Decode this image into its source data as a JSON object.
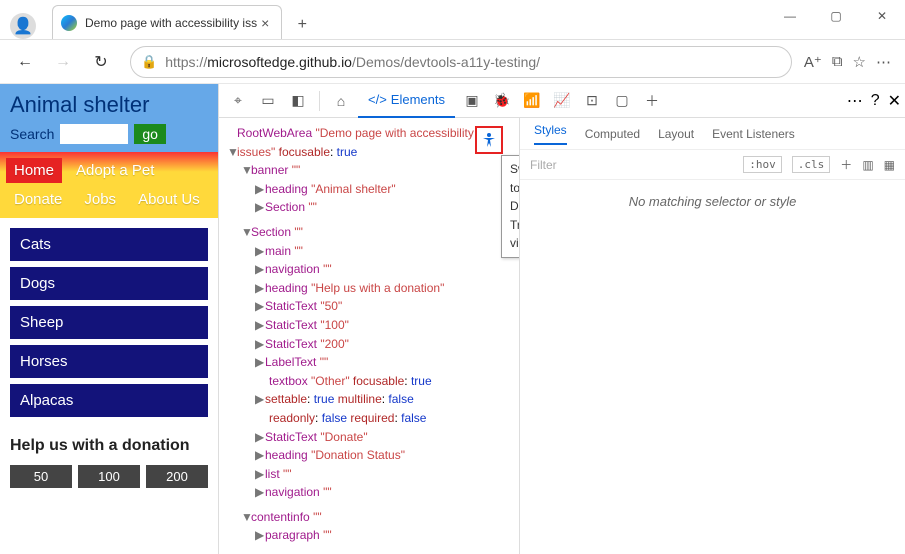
{
  "window": {
    "tab_title": "Demo page with accessibility iss",
    "url_prefix": "https://",
    "url_host": "microsoftedge.github.io",
    "url_path": "/Demos/devtools-a11y-testing/"
  },
  "page": {
    "title": "Animal shelter",
    "search_label": "Search",
    "go_label": "go",
    "nav": [
      "Home",
      "Adopt a Pet",
      "Donate",
      "Jobs",
      "About Us"
    ],
    "side": [
      "Cats",
      "Dogs",
      "Sheep",
      "Horses",
      "Alpacas"
    ],
    "donate_heading": "Help us with a donation",
    "donate_amounts": [
      "50",
      "100",
      "200"
    ]
  },
  "devtools": {
    "elements_tab": "Elements",
    "tooltip": "Switch to DOM Tree view",
    "styles_tabs": [
      "Styles",
      "Computed",
      "Layout",
      "Event Listeners"
    ],
    "filter_placeholder": "Filter",
    "hov": ":hov",
    "cls": ".cls",
    "no_match": "No matching selector or style"
  },
  "tree": {
    "root_role": "RootWebArea",
    "root_name1": "\"Demo page with accessibility",
    "root_name2": "issues\"",
    "focusable": "focusable",
    "true": "true",
    "false": "false",
    "banner": "banner",
    "heading": "heading",
    "animal_shelter": "\"Animal shelter\"",
    "section": "Section",
    "main": "main",
    "navigation": "navigation",
    "help_donation": "\"Help us with a donation\"",
    "static_text": "StaticText",
    "fifty": "\"50\"",
    "hundred": "\"100\"",
    "twohundred": "\"200\"",
    "label_text": "LabelText",
    "textbox": "textbox",
    "other": "\"Other\"",
    "settable": "settable",
    "multiline": "multiline",
    "readonly": "readonly",
    "required": "required",
    "donate": "\"Donate\"",
    "donation_status": "\"Donation Status\"",
    "list": "list",
    "contentinfo": "contentinfo",
    "paragraph": "paragraph",
    "empty": "\"\""
  }
}
